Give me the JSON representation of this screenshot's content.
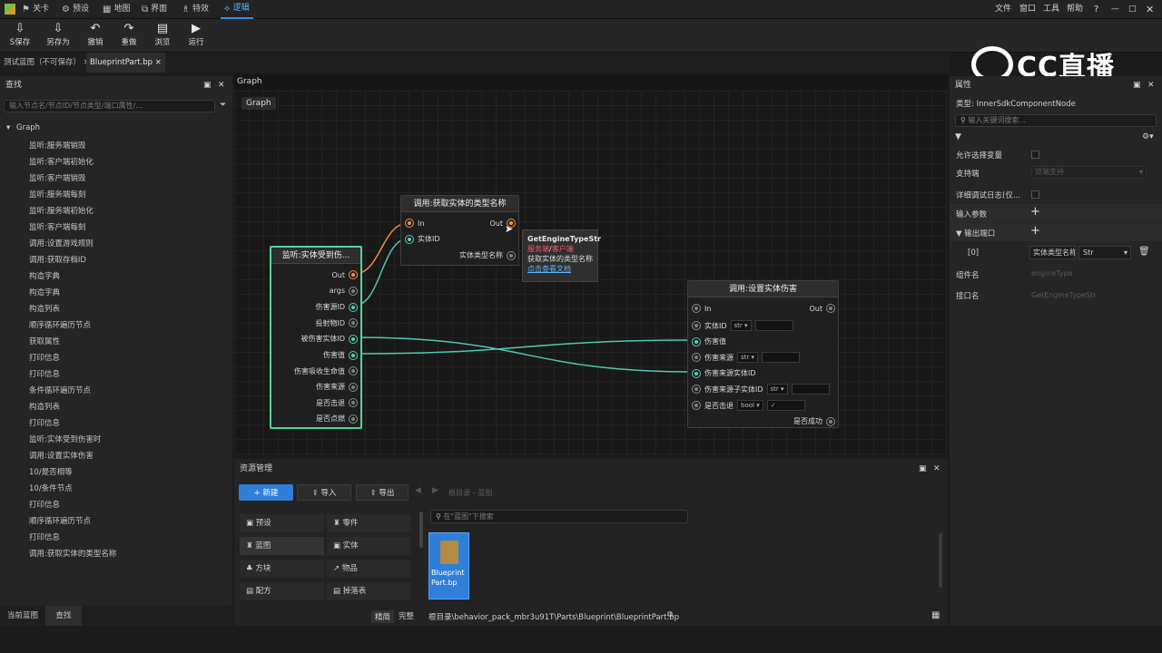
{
  "menubar": {
    "tabs": [
      {
        "label": "关卡",
        "icon": "level-icon"
      },
      {
        "label": "预设",
        "icon": "preset-icon"
      },
      {
        "label": "地图",
        "icon": "map-icon"
      },
      {
        "label": "界面",
        "icon": "ui-icon"
      },
      {
        "label": "特效",
        "icon": "effect-icon"
      },
      {
        "label": "逻辑",
        "icon": "logic-icon"
      }
    ],
    "menus": [
      "文件",
      "窗口",
      "工具",
      "帮助"
    ]
  },
  "toolbar": {
    "save": "S保存",
    "save_as": "另存为",
    "undo": "撤销",
    "redo": "重做",
    "browse": "浏览",
    "run": "运行"
  },
  "doc_tabs": [
    "测试蓝图（不可保存）",
    "BlueprintPart.bp"
  ],
  "watermark": "CC直播",
  "find_panel": {
    "title": "查找",
    "search_placeholder": "输入节点名/节点ID/节点类型/端口属性/...",
    "root": "Graph",
    "items": [
      "监听:服务端销毁",
      "监听:客户端初始化",
      "监听:客户端销毁",
      "监听:服务端每刻",
      "监听:服务端初始化",
      "监听:客户端每刻",
      "调用:设置游戏规则",
      "调用:获取存档ID",
      "构造字典",
      "构造字典",
      "构造列表",
      "顺序循环遍历节点",
      "获取属性",
      "打印信息",
      "打印信息",
      "条件循环遍历节点",
      "构造列表",
      "打印信息",
      "监听:实体受到伤害时",
      "调用:设置实体伤害",
      "10/是否相等",
      "10/条件节点",
      "打印信息",
      "顺序循环遍历节点",
      "打印信息",
      "调用:获取实体的类型名称"
    ],
    "footer_tabs": [
      "当前蓝图",
      "查找"
    ]
  },
  "graph": {
    "panel_title": "Graph",
    "badge": "Graph",
    "node_listen": {
      "title": "监听:实体受到伤...",
      "ports": [
        "Out",
        "args",
        "伤害源ID",
        "投射物ID",
        "被伤害实体ID",
        "伤害值",
        "伤害吸收生命值",
        "伤害来源",
        "是否击退",
        "是否点燃"
      ]
    },
    "node_gettype": {
      "title": "调用:获取实体的类型名称",
      "in": "In",
      "entity": "实体ID",
      "out": "Out",
      "result": "实体类型名称"
    },
    "tooltip": {
      "name": "GetEngineTypeStr",
      "side_a": "服务端",
      "sep": "/",
      "side_b": "客户端",
      "desc": "获取实体的类型名称",
      "link": "点击查看文档"
    },
    "node_setdamage": {
      "title": "调用:设置实体伤害",
      "in": "In",
      "out": "Out",
      "entity": "实体ID",
      "entity_type": "str",
      "damage": "伤害值",
      "source": "伤害来源",
      "source_type": "str",
      "source_entity": "伤害来源实体ID",
      "child_entity": "伤害来源子实体ID",
      "child_type": "str",
      "knock": "是否击退",
      "knock_type": "bool",
      "success": "是否成功"
    }
  },
  "assets": {
    "title": "资源管理",
    "new": "新建",
    "import": "导入",
    "export": "导出",
    "breadcrumb_root": "根目录",
    "breadcrumb_leaf": "蓝图",
    "categories": [
      "预设",
      "零件",
      "蓝图",
      "实体",
      "方块",
      "物品",
      "配方",
      "掉落表"
    ],
    "search_placeholder": "在\"蓝图\"下搜索",
    "file_name": "BlueprintPart.bp",
    "mode_simple": "精简",
    "mode_full": "完整",
    "path": "根目录\\behavior_pack_mbr3u91T\\Parts\\Blueprint\\BlueprintPart.bp"
  },
  "properties": {
    "title": "属性",
    "type_label": "类型: InnerSdkComponentNode",
    "search_placeholder": "输入关键词搜索...",
    "allow_var": "允许选择变量",
    "support": "支持端",
    "support_value": "双端支持",
    "debug_log": "详细调试日志(仅...",
    "input_params": "输入参数",
    "output_ports": "输出端口",
    "output_index": "[0]",
    "output_name": "实体类型名称",
    "output_type": "Str",
    "component_name": "组件名",
    "component_value": "engineType",
    "interface_name": "接口名",
    "interface_value": "GetEngineTypeStr"
  }
}
